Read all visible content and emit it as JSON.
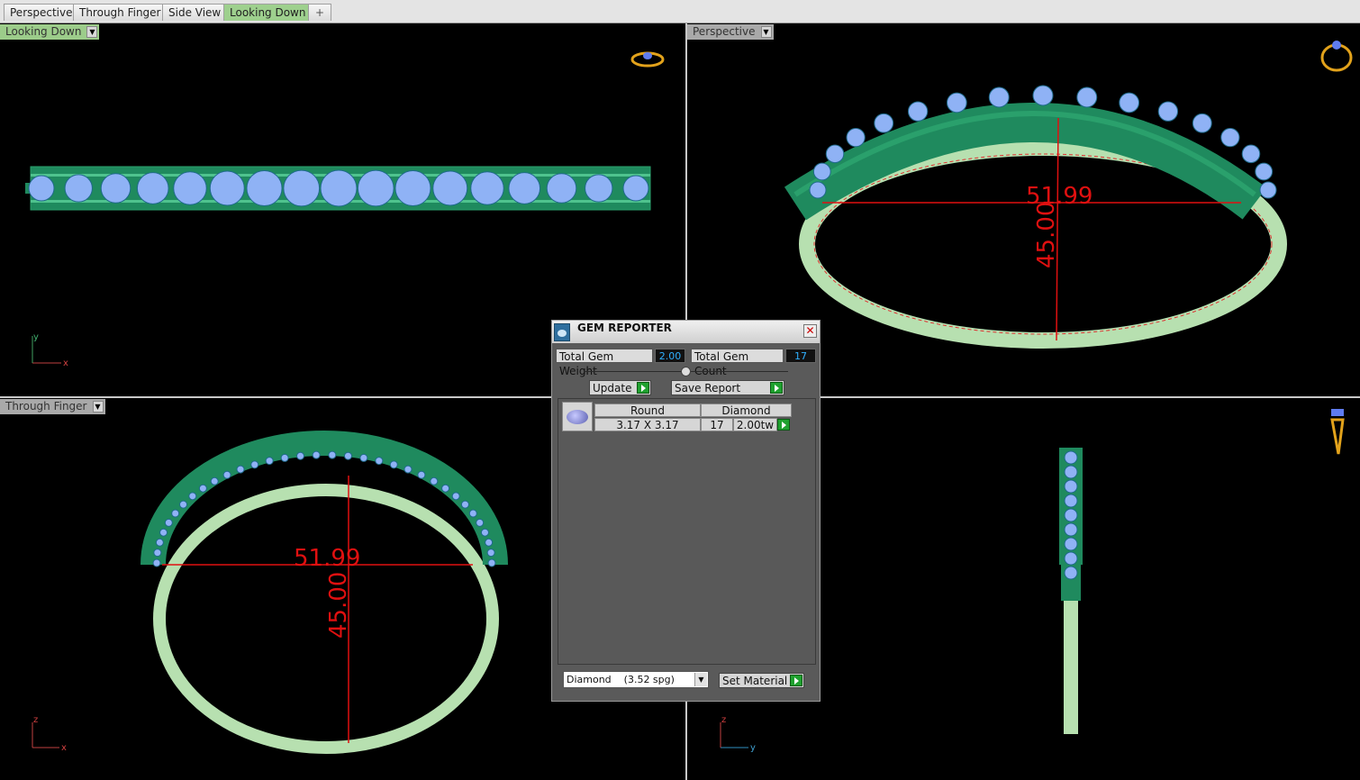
{
  "tabs": [
    {
      "label": "Perspective",
      "active": false
    },
    {
      "label": "Through Finger",
      "active": false
    },
    {
      "label": "Side View",
      "active": false
    },
    {
      "label": "Looking Down",
      "active": true
    }
  ],
  "tab_add_glyph": "+",
  "viewports": {
    "top_left": {
      "label": "Looking Down",
      "axis": [
        "y",
        "x"
      ]
    },
    "top_right": {
      "label": "Perspective"
    },
    "bottom_left": {
      "label": "Through Finger",
      "axis": [
        "z",
        "x"
      ]
    },
    "bottom_right": {
      "label": "",
      "axis": [
        "z",
        "y"
      ]
    }
  },
  "dimensions": {
    "width": "51.99",
    "height": "45.00"
  },
  "gem_reporter": {
    "title": "GEM REPORTER",
    "total_weight_label": "Total Gem Weight",
    "total_weight_value": "2.00",
    "total_count_label": "Total Gem Count",
    "total_count_value": "17",
    "update_label": "Update",
    "save_label": "Save Report",
    "table_headers": [
      "Round",
      "Diamond"
    ],
    "row": {
      "size": "3.17 X 3.17",
      "count": "17",
      "weight": "2.00tw"
    },
    "material_select": "Diamond    (3.52 spg)",
    "set_material_label": "Set Material"
  },
  "colors": {
    "model_green": "#1f8a5e",
    "model_light": "#b7e0b0",
    "gem_blue": "#8fb2f5",
    "dimension_red": "#e01010",
    "active_tab": "#9ed08e"
  }
}
